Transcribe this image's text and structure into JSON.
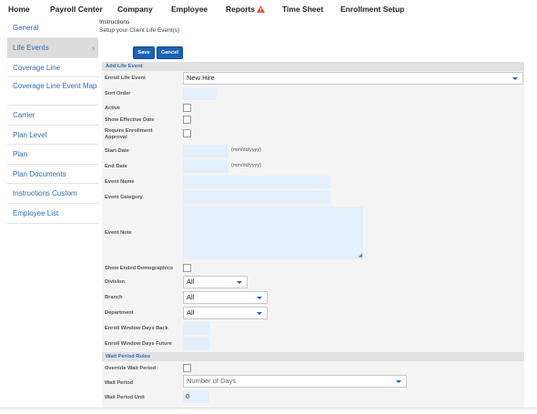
{
  "nav": {
    "home": "Home",
    "payroll_center": "Payroll Center",
    "company": "Company",
    "employee": "Employee",
    "reports": "Reports",
    "time_sheet": "Time Sheet",
    "enrollment_setup": "Enrollment Setup",
    "warning_icon": "warning-triangle-icon",
    "warning_color": "#e24a2b"
  },
  "sidebar": {
    "items": [
      {
        "label": "General"
      },
      {
        "label": "Life Events",
        "active": true
      },
      {
        "label": "Coverage Line"
      },
      {
        "label": "Coverage Line Event Map"
      },
      {
        "label": "Carrier"
      },
      {
        "label": "Plan Level"
      },
      {
        "label": "Plan"
      },
      {
        "label": "Plan Documents"
      },
      {
        "label": "Instructions Custom"
      },
      {
        "label": "Employee List"
      }
    ],
    "active_chevron": "›"
  },
  "main": {
    "instructions_title": "Instructions",
    "instructions_sub": "Setup your Client Life Event(s)",
    "save_label": "Save",
    "cancel_label": "Cancel",
    "accent_color": "#1a63b4"
  },
  "form": {
    "section_add": "Add Life Event",
    "enroll_life_event_label": "Enroll Life Event",
    "enroll_life_event_value": "New Hire",
    "sort_order_label": "Sort Order",
    "active_label": "Active",
    "show_effective_date_label": "Show Effective Date",
    "require_enrollment_approval_label_1": "Require Enrollment",
    "require_enrollment_approval_label_2": "Approval",
    "start_date_label": "Start Date",
    "start_date_hint": "(mm/dd/yyyy)",
    "end_date_label": "End Date",
    "end_date_hint": "(mm/dd/yyyy)",
    "event_name_label": "Event Name",
    "event_category_label": "Event Category",
    "event_note_label": "Event Note",
    "show_ended_demographics_label": "Show Ended Demographics",
    "division_label": "Division",
    "division_value": "All",
    "branch_label": "Branch",
    "branch_value": "All",
    "department_label": "Department",
    "department_value": "All",
    "enroll_window_days_back_label": "Enroll Window Days Back",
    "enroll_window_days_future_label": "Enroll Window Days Future",
    "section_wait": "Wait Period Rules",
    "override_wait_period_label": "Override Wait Period",
    "wait_period_label": "Wait Period",
    "wait_period_value": "Number of Days",
    "wait_period_unit_label": "Wait Period Unit",
    "wait_period_unit_value": "0"
  }
}
